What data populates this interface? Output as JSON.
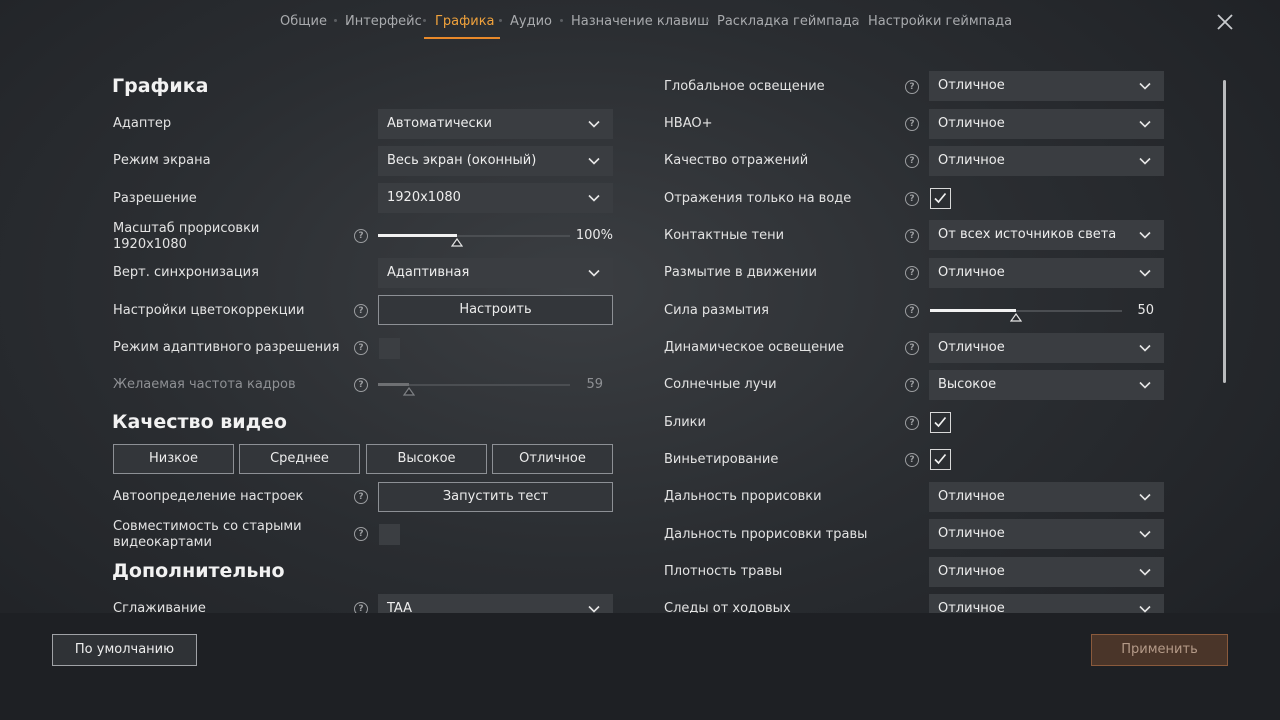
{
  "tabs": [
    {
      "label": "Общие"
    },
    {
      "label": "Интерфейс"
    },
    {
      "label": "Графика"
    },
    {
      "label": "Аудио"
    },
    {
      "label": "Назначение клавиш"
    },
    {
      "label": "Раскладка геймпада"
    },
    {
      "label": "Настройки геймпада"
    }
  ],
  "active_tab": "Графика",
  "accent_color": "#e8892a",
  "left": {
    "graphics_header": "Графика",
    "adapter": {
      "label": "Адаптер",
      "value": "Автоматически"
    },
    "screen_mode": {
      "label": "Режим экрана",
      "value": "Весь экран (оконный)"
    },
    "resolution": {
      "label": "Разрешение",
      "value": "1920x1080"
    },
    "render_scale": {
      "label_line1": "Масштаб прорисовки",
      "label_line2": "1920x1080",
      "value_text": "100%",
      "fraction": 0.33
    },
    "vsync": {
      "label": "Верт. синхронизация",
      "value": "Адаптивная"
    },
    "color_correction": {
      "label": "Настройки цветокоррекции",
      "button": "Настроить"
    },
    "adaptive_resolution": {
      "label": "Режим адаптивного разрешения",
      "checked": false
    },
    "target_fps": {
      "label": "Желаемая частота кадров",
      "value_text": "59",
      "fraction": 0.16
    },
    "video_quality_header": "Качество видео",
    "presets": [
      "Низкое",
      "Среднее",
      "Высокое",
      "Отличное"
    ],
    "auto_detect": {
      "label": "Автоопределение настроек",
      "button": "Запустить тест"
    },
    "legacy_gpu": {
      "label_line1": "Совместимость со старыми",
      "label_line2": "видеокартами",
      "checked": false
    },
    "extra_header": "Дополнительно",
    "antialiasing": {
      "label": "Сглаживание",
      "value": "TAA"
    }
  },
  "right": {
    "global_illumination": {
      "label": "Глобальное освещение",
      "value": "Отличное"
    },
    "hbao": {
      "label": "HBAO+",
      "value": "Отличное"
    },
    "reflection_quality": {
      "label": "Качество отражений",
      "value": "Отличное"
    },
    "water_reflections_only": {
      "label": "Отражения только на воде",
      "checked": true
    },
    "contact_shadows": {
      "label": "Контактные тени",
      "value": "От всех источников света"
    },
    "motion_blur": {
      "label": "Размытие в движении",
      "value": "Отличное"
    },
    "blur_strength": {
      "label": "Сила размытия",
      "value_text": "50",
      "value": 50
    },
    "dynamic_lighting": {
      "label": "Динамическое освещение",
      "value": "Отличное"
    },
    "sun_rays": {
      "label": "Солнечные лучи",
      "value": "Высокое"
    },
    "glare": {
      "label": "Блики",
      "checked": true
    },
    "vignette": {
      "label": "Виньетирование",
      "checked": true
    },
    "draw_distance": {
      "label": "Дальность прорисовки",
      "value": "Отличное"
    },
    "grass_draw_distance": {
      "label": "Дальность прорисовки травы",
      "value": "Отличное"
    },
    "grass_density": {
      "label": "Плотность травы",
      "value": "Отличное"
    },
    "track_marks": {
      "label": "Следы от ходовых",
      "value": "Отличное"
    }
  },
  "footer": {
    "default_button": "По умолчанию",
    "apply_button": "Применить"
  }
}
